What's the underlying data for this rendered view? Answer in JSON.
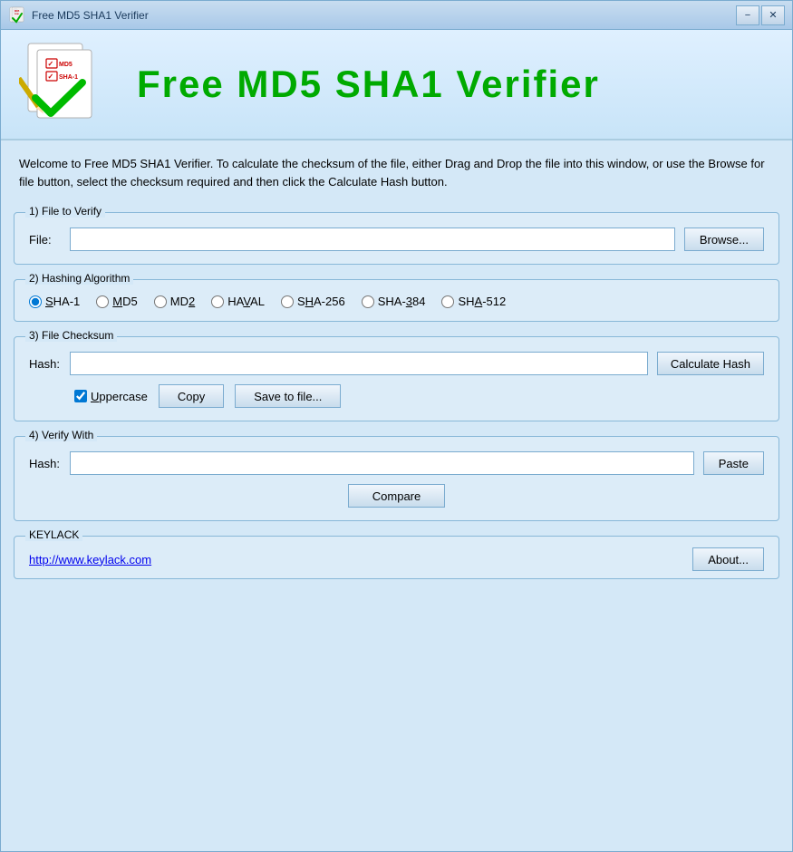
{
  "window": {
    "title": "Free MD5 SHA1 Verifier",
    "minimize_label": "−",
    "close_label": "✕"
  },
  "header": {
    "title": "Free  MD5  SHA1  Verifier"
  },
  "welcome": {
    "text": "Welcome to Free MD5 SHA1 Verifier. To calculate the checksum of the file, either Drag and Drop the file into this window, or use the Browse for file button, select the checksum required and then click the Calculate Hash button."
  },
  "sections": {
    "file": {
      "title": "1) File to Verify",
      "label": "File:",
      "input_value": "",
      "browse_label": "Browse..."
    },
    "algorithm": {
      "title": "2) Hashing Algorithm",
      "options": [
        {
          "id": "sha1",
          "label": "SHA-1",
          "checked": true
        },
        {
          "id": "md5",
          "label": "MD5",
          "checked": false
        },
        {
          "id": "md2",
          "label": "MD2",
          "checked": false
        },
        {
          "id": "haval",
          "label": "HAVAL",
          "checked": false
        },
        {
          "id": "sha256",
          "label": "SHA-256",
          "checked": false
        },
        {
          "id": "sha384",
          "label": "SHA-384",
          "checked": false
        },
        {
          "id": "sha512",
          "label": "SHA-512",
          "checked": false
        }
      ]
    },
    "checksum": {
      "title": "3) File Checksum",
      "hash_label": "Hash:",
      "hash_value": "",
      "calculate_label": "Calculate Hash",
      "uppercase_label": "Uppercase",
      "uppercase_checked": true,
      "copy_label": "Copy",
      "save_label": "Save to file..."
    },
    "verify": {
      "title": "4) Verify With",
      "hash_label": "Hash:",
      "hash_value": "",
      "paste_label": "Paste",
      "compare_label": "Compare"
    },
    "footer": {
      "title": "KEYLACK",
      "link_text": "http://www.keylack.com",
      "about_label": "About..."
    }
  }
}
